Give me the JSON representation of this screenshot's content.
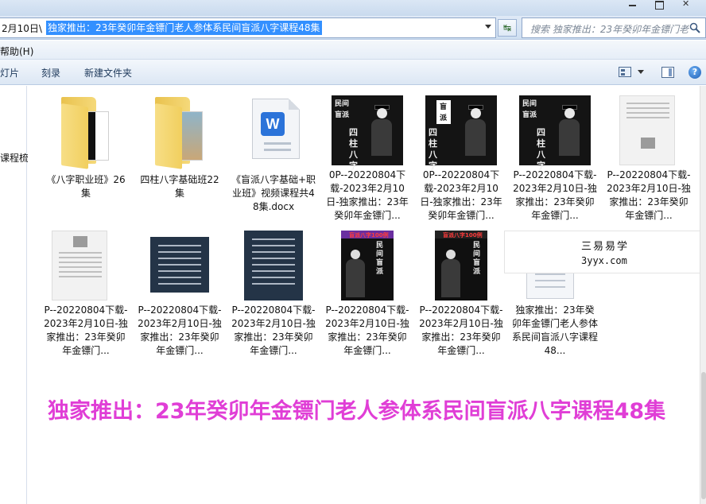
{
  "address_bar": {
    "prefix": "2月10日\\",
    "selected_path": "独家推出：23年癸卯年金镖门老人参体系民间盲派八字课程48集"
  },
  "search": {
    "placeholder": "搜索 独家推出：23年癸卯年金镖门老..."
  },
  "menu": {
    "help_label": "帮助(H)"
  },
  "toolbar": {
    "item1": "灯片",
    "item2": "刻录",
    "item3": "新建文件夹"
  },
  "nav": {
    "item": "课程梳"
  },
  "files": [
    {
      "label": "《八字职业班》26集",
      "kind": "folder"
    },
    {
      "label": "四柱八字基础班22集",
      "kind": "folder"
    },
    {
      "label": "《盲派八字基础+职业班》视频课程共48集.docx",
      "kind": "docx"
    },
    {
      "label": "0P--20220804下载-2023年2月10日-独家推出：23年癸卯年金镖门...",
      "kind": "dark-image",
      "thumb_text": "民间盲派",
      "thumb_title": "四柱八字"
    },
    {
      "label": "0P--20220804下载-2023年2月10日-独家推出：23年癸卯年金镖门...",
      "kind": "dark-image-sign",
      "thumb_text": "盲派",
      "thumb_title": "四柱八字"
    },
    {
      "label": "P--20220804下载-2023年2月10日-独家推出：23年癸卯年金镖门...",
      "kind": "dark-image",
      "thumb_text": "民间盲派",
      "thumb_title": "四柱八字"
    },
    {
      "label": "P--20220804下载-2023年2月10日-独家推出：23年癸卯年金镖门...",
      "kind": "paper"
    },
    {
      "label": "P--20220804下载-2023年2月10日-独家推出：23年癸卯年金镖门...",
      "kind": "paper"
    },
    {
      "label": "P--20220804下载-2023年2月10日-独家推出：23年癸卯年金镖门...",
      "kind": "list"
    },
    {
      "label": "P--20220804下载-2023年2月10日-独家推出：23年癸卯年金镖门...",
      "kind": "list"
    },
    {
      "label": "P--20220804下载-2023年2月10日-独家推出：23年癸卯年金镖门...",
      "kind": "poster",
      "poster_top": "盲派八字100例",
      "poster_text": "民间盲派"
    },
    {
      "label": "P--20220804下载-2023年2月10日-独家推出：23年癸卯年金镖门...",
      "kind": "poster",
      "poster_top": "盲派八字100例",
      "poster_text": "民间盲派"
    },
    {
      "label": "独家推出：23年癸卯年金镖门老人参体系民间盲派八字课程48...",
      "kind": "generic-doc"
    }
  ],
  "watermark": {
    "name": "三易易学",
    "url": "3yyx.com"
  },
  "headline": "独家推出：23年癸卯年金镖门老人参体系民间盲派八字课程48集",
  "colors": {
    "headline": "#e03ed6",
    "selection": "#3390ff"
  }
}
